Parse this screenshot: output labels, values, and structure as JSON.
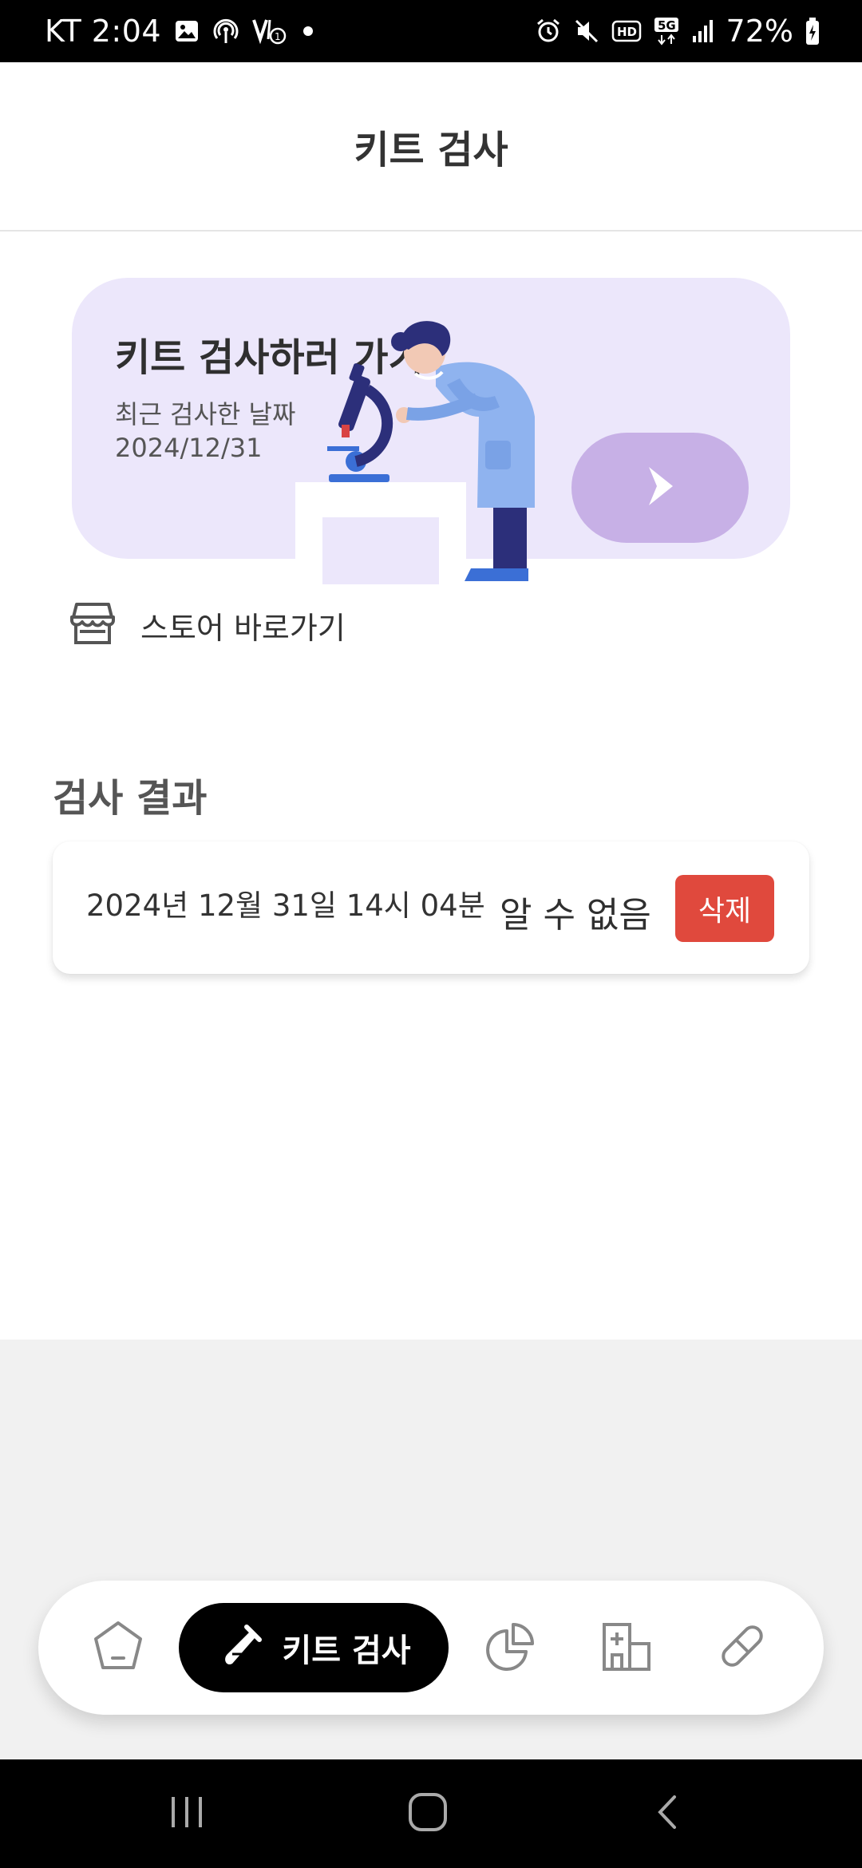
{
  "status_bar": {
    "carrier_time": "KT 2:04",
    "battery": "72%",
    "icons_left": [
      "image-icon",
      "hotspot-icon",
      "volte-icon",
      "dot-icon"
    ],
    "icons_right": [
      "alarm-icon",
      "mute-icon",
      "hd-icon",
      "5g-icon",
      "signal-icon",
      "battery-charging-icon"
    ]
  },
  "header": {
    "title": "키트 검사"
  },
  "kit_card": {
    "title": "키트 검사하러 가기",
    "recent_label": "최근 검사한 날짜",
    "recent_date": "2024/12/31",
    "go_icon": "chevron-right-icon",
    "colors": {
      "card_bg": "#ece7fb",
      "button_bg": "#c7b0e6"
    }
  },
  "store_link": {
    "label": "스토어 바로가기",
    "icon": "store-icon"
  },
  "results": {
    "title": "검사 결과",
    "items": [
      {
        "datetime": "2024년 12월 31일 14시 04분",
        "status": "알 수 없음",
        "delete_label": "삭제"
      }
    ],
    "colors": {
      "delete_bg": "#e0493d"
    }
  },
  "bottom_nav": {
    "active_label": "키트 검사",
    "items": [
      {
        "icon": "pentagon-home-icon"
      },
      {
        "icon": "test-tube-icon",
        "label": "키트 검사",
        "active": true
      },
      {
        "icon": "pie-chart-icon"
      },
      {
        "icon": "hospital-icon"
      },
      {
        "icon": "pill-icon"
      }
    ]
  },
  "system_nav": {
    "buttons": [
      "recents-icon",
      "home-icon",
      "back-icon"
    ]
  }
}
